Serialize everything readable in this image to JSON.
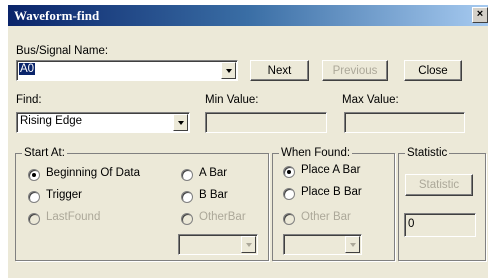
{
  "window": {
    "title": "Waveform-find",
    "close_glyph": "×"
  },
  "bus": {
    "label": "Bus/Signal Name:",
    "value": "A0"
  },
  "buttons": {
    "next": "Next",
    "previous": "Previous",
    "close": "Close"
  },
  "find": {
    "label": "Find:",
    "value": "Rising Edge",
    "min_label": "Min Value:",
    "max_label": "Max Value:"
  },
  "start_at": {
    "legend": "Start At:",
    "options": [
      "Beginning Of Data",
      "Trigger",
      "LastFound",
      "A Bar",
      "B Bar",
      "OtherBar"
    ],
    "selected": "Beginning Of Data"
  },
  "when_found": {
    "legend": "When Found:",
    "options": [
      "Place A Bar",
      "Place B Bar",
      "Other Bar"
    ],
    "selected": "Place A Bar"
  },
  "statistic": {
    "legend": "Statistic",
    "button": "Statistic",
    "value": "0"
  }
}
